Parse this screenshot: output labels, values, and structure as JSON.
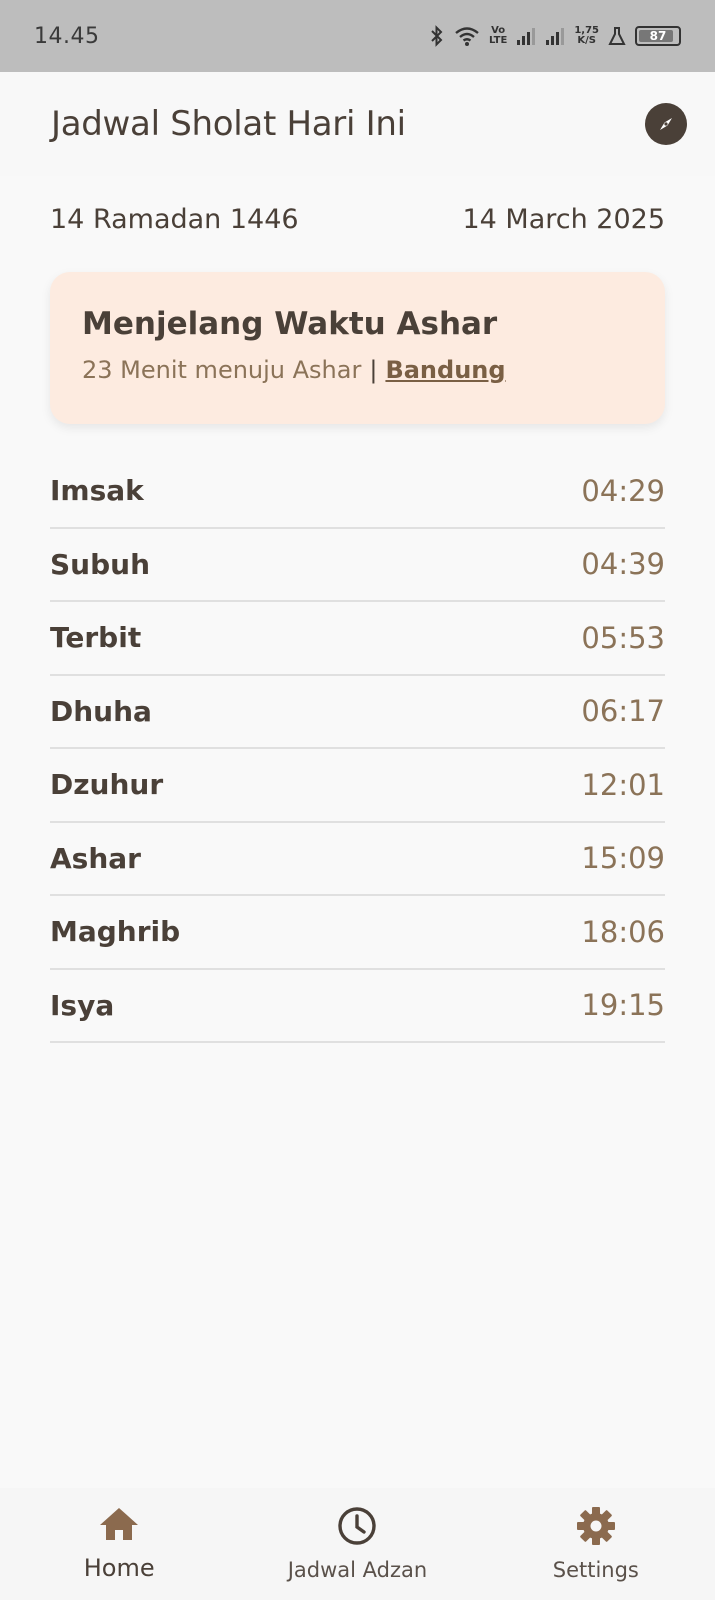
{
  "status_bar": {
    "time": "14.45",
    "volte_top": "Vo",
    "volte_bottom": "LTE",
    "speed_value": "1,75",
    "speed_unit": "K/S",
    "battery": "87",
    "icons": [
      "bluetooth-icon",
      "wifi-icon",
      "volte-icon",
      "signal-icon",
      "signal-icon",
      "network-speed",
      "lab-icon",
      "battery-icon"
    ]
  },
  "app_bar": {
    "title": "Jadwal Sholat Hari Ini",
    "action_icon": "compass-icon"
  },
  "dates": {
    "hijri": "14 Ramadan 1446",
    "gregorian": "14 March 2025"
  },
  "next_prayer": {
    "title": "Menjelang Waktu Ashar",
    "countdown": "23 Menit menuju Ashar",
    "separator": "|",
    "city": "Bandung"
  },
  "schedule": [
    {
      "name": "Imsak",
      "time": "04:29"
    },
    {
      "name": "Subuh",
      "time": "04:39"
    },
    {
      "name": "Terbit",
      "time": "05:53"
    },
    {
      "name": "Dhuha",
      "time": "06:17"
    },
    {
      "name": "Dzuhur",
      "time": "12:01"
    },
    {
      "name": "Ashar",
      "time": "15:09"
    },
    {
      "name": "Maghrib",
      "time": "18:06"
    },
    {
      "name": "Isya",
      "time": "19:15"
    }
  ],
  "bottom_nav": {
    "items": [
      {
        "label": "Home",
        "icon": "home-icon",
        "active": true
      },
      {
        "label": "Jadwal Adzan",
        "icon": "clock-icon",
        "active": false
      },
      {
        "label": "Settings",
        "icon": "gear-icon",
        "active": false
      }
    ]
  },
  "colors": {
    "primary_text": "#4a4038",
    "accent": "#8b7358",
    "card_bg": "#fdebe0",
    "icon_brown": "#8b6a4e"
  }
}
